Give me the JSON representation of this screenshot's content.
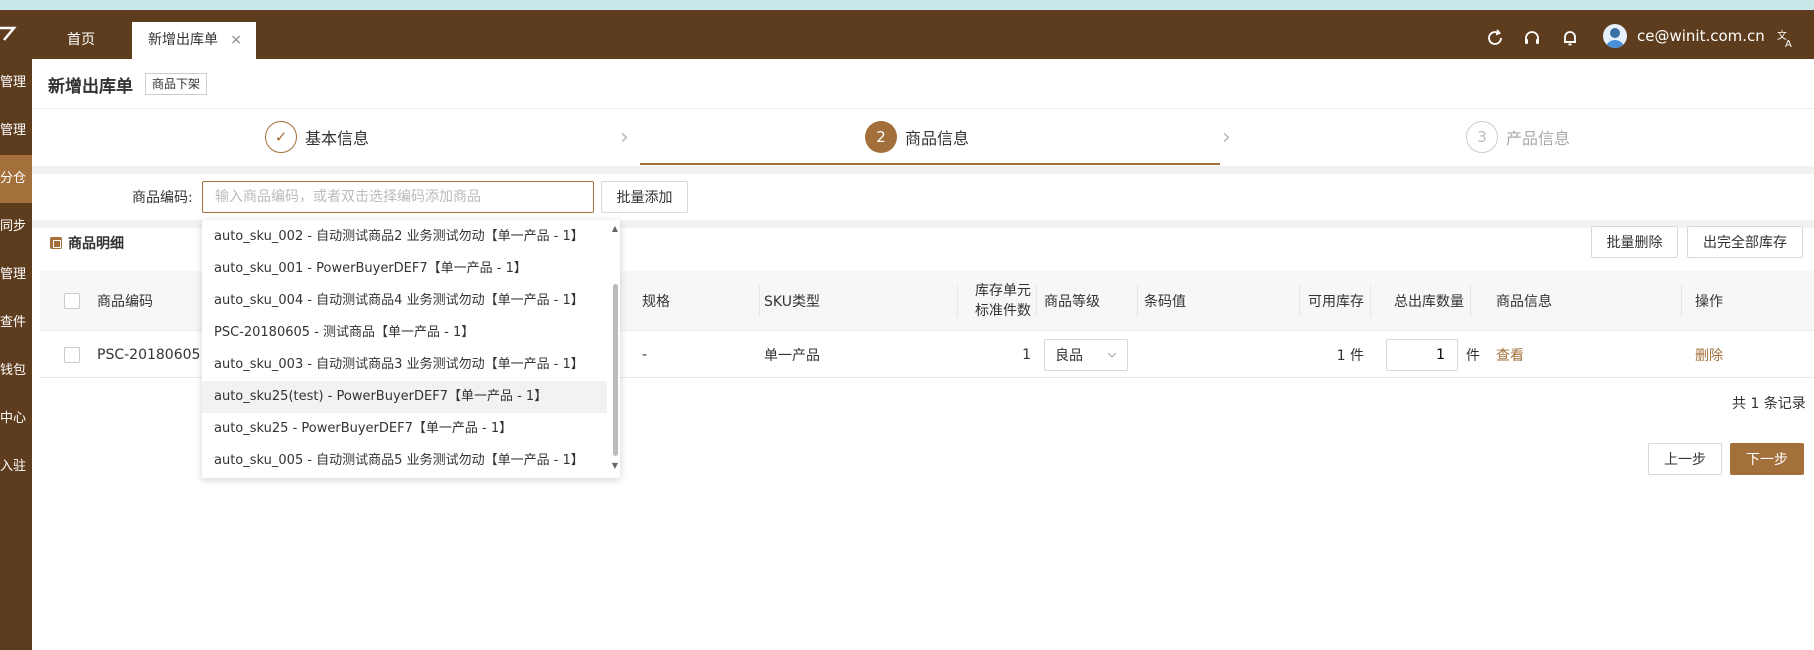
{
  "header": {
    "tabs": [
      {
        "label": "首页",
        "active": false
      },
      {
        "label": "新增出库单",
        "active": true,
        "close": "×"
      }
    ],
    "user_email": "ce@winit.com.cn",
    "icons": [
      "refresh-icon",
      "headset-icon",
      "bell-icon",
      "avatar",
      "translate-icon"
    ],
    "brand_color": "#5e3d1f",
    "accent_color": "#a36f3b"
  },
  "sidebar": {
    "items": [
      {
        "label": "管理",
        "active": false
      },
      {
        "label": "管理",
        "active": false
      },
      {
        "label": "分仓",
        "active": true
      },
      {
        "label": "同步",
        "active": false
      },
      {
        "label": "管理",
        "active": false
      },
      {
        "label": "查件",
        "active": false
      },
      {
        "label": "钱包",
        "active": false
      },
      {
        "label": "中心",
        "active": false
      },
      {
        "label": "入驻",
        "active": false
      }
    ]
  },
  "page": {
    "title": "新增出库单",
    "tag": "商品下架"
  },
  "steps": [
    {
      "number": "✓",
      "label": "基本信息",
      "status": "done"
    },
    {
      "number": "2",
      "label": "商品信息",
      "status": "active"
    },
    {
      "number": "3",
      "label": "产品信息",
      "status": "pending"
    }
  ],
  "search": {
    "label": "商品编码:",
    "placeholder": "输入商品编码，或者双击选择编码添加商品",
    "batch_add_label": "批量添加"
  },
  "details": {
    "title": "商品明细",
    "batch_delete_label": "批量删除",
    "out_all_label": "出完全部库存"
  },
  "table": {
    "headers": {
      "code": "商品编码",
      "spec": "规格",
      "sku_type": "SKU类型",
      "unit_qty_line1": "库存单元",
      "unit_qty_line2": "标准件数",
      "grade": "商品等级",
      "barcode": "条码值",
      "available": "可用库存",
      "total_out": "总出库数量",
      "product_info": "商品信息",
      "action": "操作"
    },
    "rows": [
      {
        "code": "PSC-20180605",
        "spec": "-",
        "sku_type": "单一产品",
        "unit_qty": "1",
        "grade": "良品",
        "barcode": "",
        "available": "1 件",
        "total_out": "1",
        "unit": "件",
        "view": "查看",
        "delete": "删除"
      }
    ],
    "total": "共 1 条记录"
  },
  "nav": {
    "prev_label": "上一步",
    "next_label": "下一步"
  },
  "dropdown": {
    "items": [
      "auto_sku_002 - 自动测试商品2 业务测试勿动【单一产品 - 1】",
      "auto_sku_001 - PowerBuyerDEF7【单一产品 - 1】",
      "auto_sku_004 - 自动测试商品4 业务测试勿动【单一产品 - 1】",
      "PSC-20180605 - 测试商品【单一产品 - 1】",
      "auto_sku_003 - 自动测试商品3 业务测试勿动【单一产品 - 1】",
      "auto_sku25(test) - PowerBuyerDEF7【单一产品 - 1】",
      "auto_sku25 - PowerBuyerDEF7【单一产品 - 1】",
      "auto_sku_005 - 自动测试商品5 业务测试勿动【单一产品 - 1】"
    ],
    "hover_index": 5
  }
}
